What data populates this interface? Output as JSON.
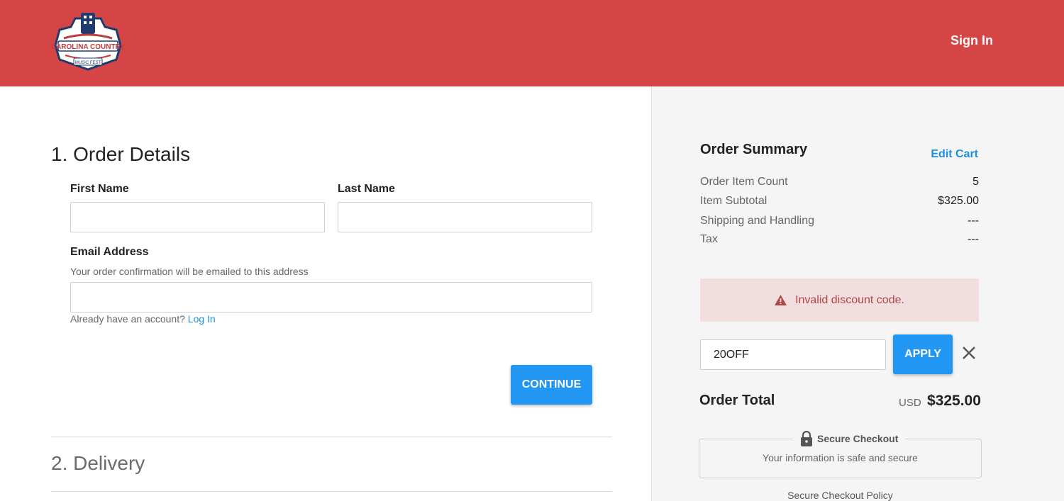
{
  "header": {
    "brand_colors": {
      "bg": "#d54546"
    },
    "logo": {
      "icon": "carolina-country-music-fest-logo",
      "text": "CAROLINA COUNTRY",
      "subtext": "MUSIC FEST"
    },
    "sign_in_label": "Sign In"
  },
  "order_details": {
    "title": "1. Order Details",
    "first_name_label": "First Name",
    "first_name_value": "",
    "last_name_label": "Last Name",
    "last_name_value": "",
    "email_label": "Email Address",
    "email_hint": "Your order confirmation will be emailed to this address",
    "email_value": "",
    "account_prompt": "Already have an account?",
    "login_link": "Log In",
    "continue_label": "CONTINUE"
  },
  "delivery": {
    "title": "2. Delivery"
  },
  "summary": {
    "title": "Order Summary",
    "edit_cart": "Edit Cart",
    "rows": [
      {
        "label": "Order Item Count",
        "value": "5"
      },
      {
        "label": "Item Subtotal",
        "value": "$325.00"
      },
      {
        "label": "Shipping and Handling",
        "value": "---"
      },
      {
        "label": "Tax",
        "value": "---"
      }
    ],
    "alert": {
      "icon": "warning-icon",
      "text": "Invalid discount code."
    },
    "discount_value": "20OFF",
    "apply_label": "APPLY",
    "total_label": "Order Total",
    "total_currency": "USD",
    "total_value": "$325.00",
    "secure_title": "Secure Checkout",
    "secure_sub": "Your information is safe and secure",
    "secure_policy": "Secure Checkout Policy"
  }
}
